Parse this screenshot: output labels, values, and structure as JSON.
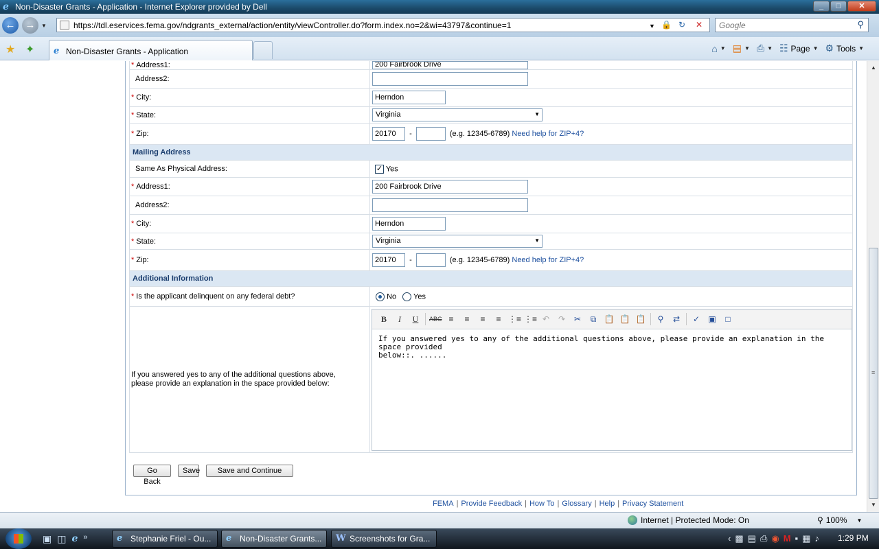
{
  "window": {
    "title": "Non-Disaster Grants - Application - Internet Explorer provided by Dell",
    "buttons": {
      "minimize": "_",
      "maximize": "□",
      "close": "✕"
    }
  },
  "browser": {
    "url": "https://tdl.eservices.fema.gov/ndgrants_external/action/entity/viewController.do?form.index.no=2&wi=43797&continue=1",
    "search_placeholder": "Google",
    "tab_title": "Non-Disaster Grants - Application",
    "commands": {
      "page": "Page",
      "tools": "Tools"
    }
  },
  "form": {
    "physical": {
      "address1_label": "Address1:",
      "address1_value": "200 Fairbrook Drive",
      "address2_label": "Address2:",
      "address2_value": "",
      "city_label": "City:",
      "city_value": "Herndon",
      "state_label": "State:",
      "state_value": "Virginia",
      "zip_label": "Zip:",
      "zip_value": "20170",
      "zip4_value": ""
    },
    "mailing": {
      "section_title": "Mailing Address",
      "same_label": "Same As Physical Address:",
      "same_checked": "✓",
      "same_value_label": "Yes",
      "address1_label": "Address1:",
      "address1_value": "200 Fairbrook Drive",
      "address2_label": "Address2:",
      "address2_value": "",
      "city_label": "City:",
      "city_value": "Herndon",
      "state_label": "State:",
      "state_value": "Virginia",
      "zip_label": "Zip:",
      "zip_value": "20170",
      "zip4_value": ""
    },
    "zip_dash": "-",
    "zip_hint": "(e.g. 12345-6789)",
    "zip_help_link": "Need help for ZIP+4?",
    "required_mark": "*",
    "additional": {
      "section_title": "Additional Information",
      "delinquent_label": "Is the applicant delinquent on any federal debt?",
      "option_no": "No",
      "option_yes": "Yes",
      "selected": "No",
      "explanation_label": "If you answered yes to any of the additional questions above, please provide an explanation in the space provided below:",
      "explanation_text": "If you answered yes to any of the additional questions above, please provide an explanation in the space provided\nbelow::. ......"
    },
    "buttons": {
      "go_back": "Go Back",
      "save": "Save",
      "save_continue": "Save and Continue"
    }
  },
  "footer": {
    "links": [
      "FEMA",
      "Provide Feedback",
      "How To",
      "Glossary",
      "Help",
      "Privacy Statement"
    ]
  },
  "status": {
    "zone": "Internet | Protected Mode: On",
    "zoom": "100%"
  },
  "taskbar": {
    "tasks": [
      "Stephanie Friel - Ou...",
      "Non-Disaster Grants...",
      "Screenshots for Gra..."
    ],
    "clock": "1:29 PM"
  }
}
